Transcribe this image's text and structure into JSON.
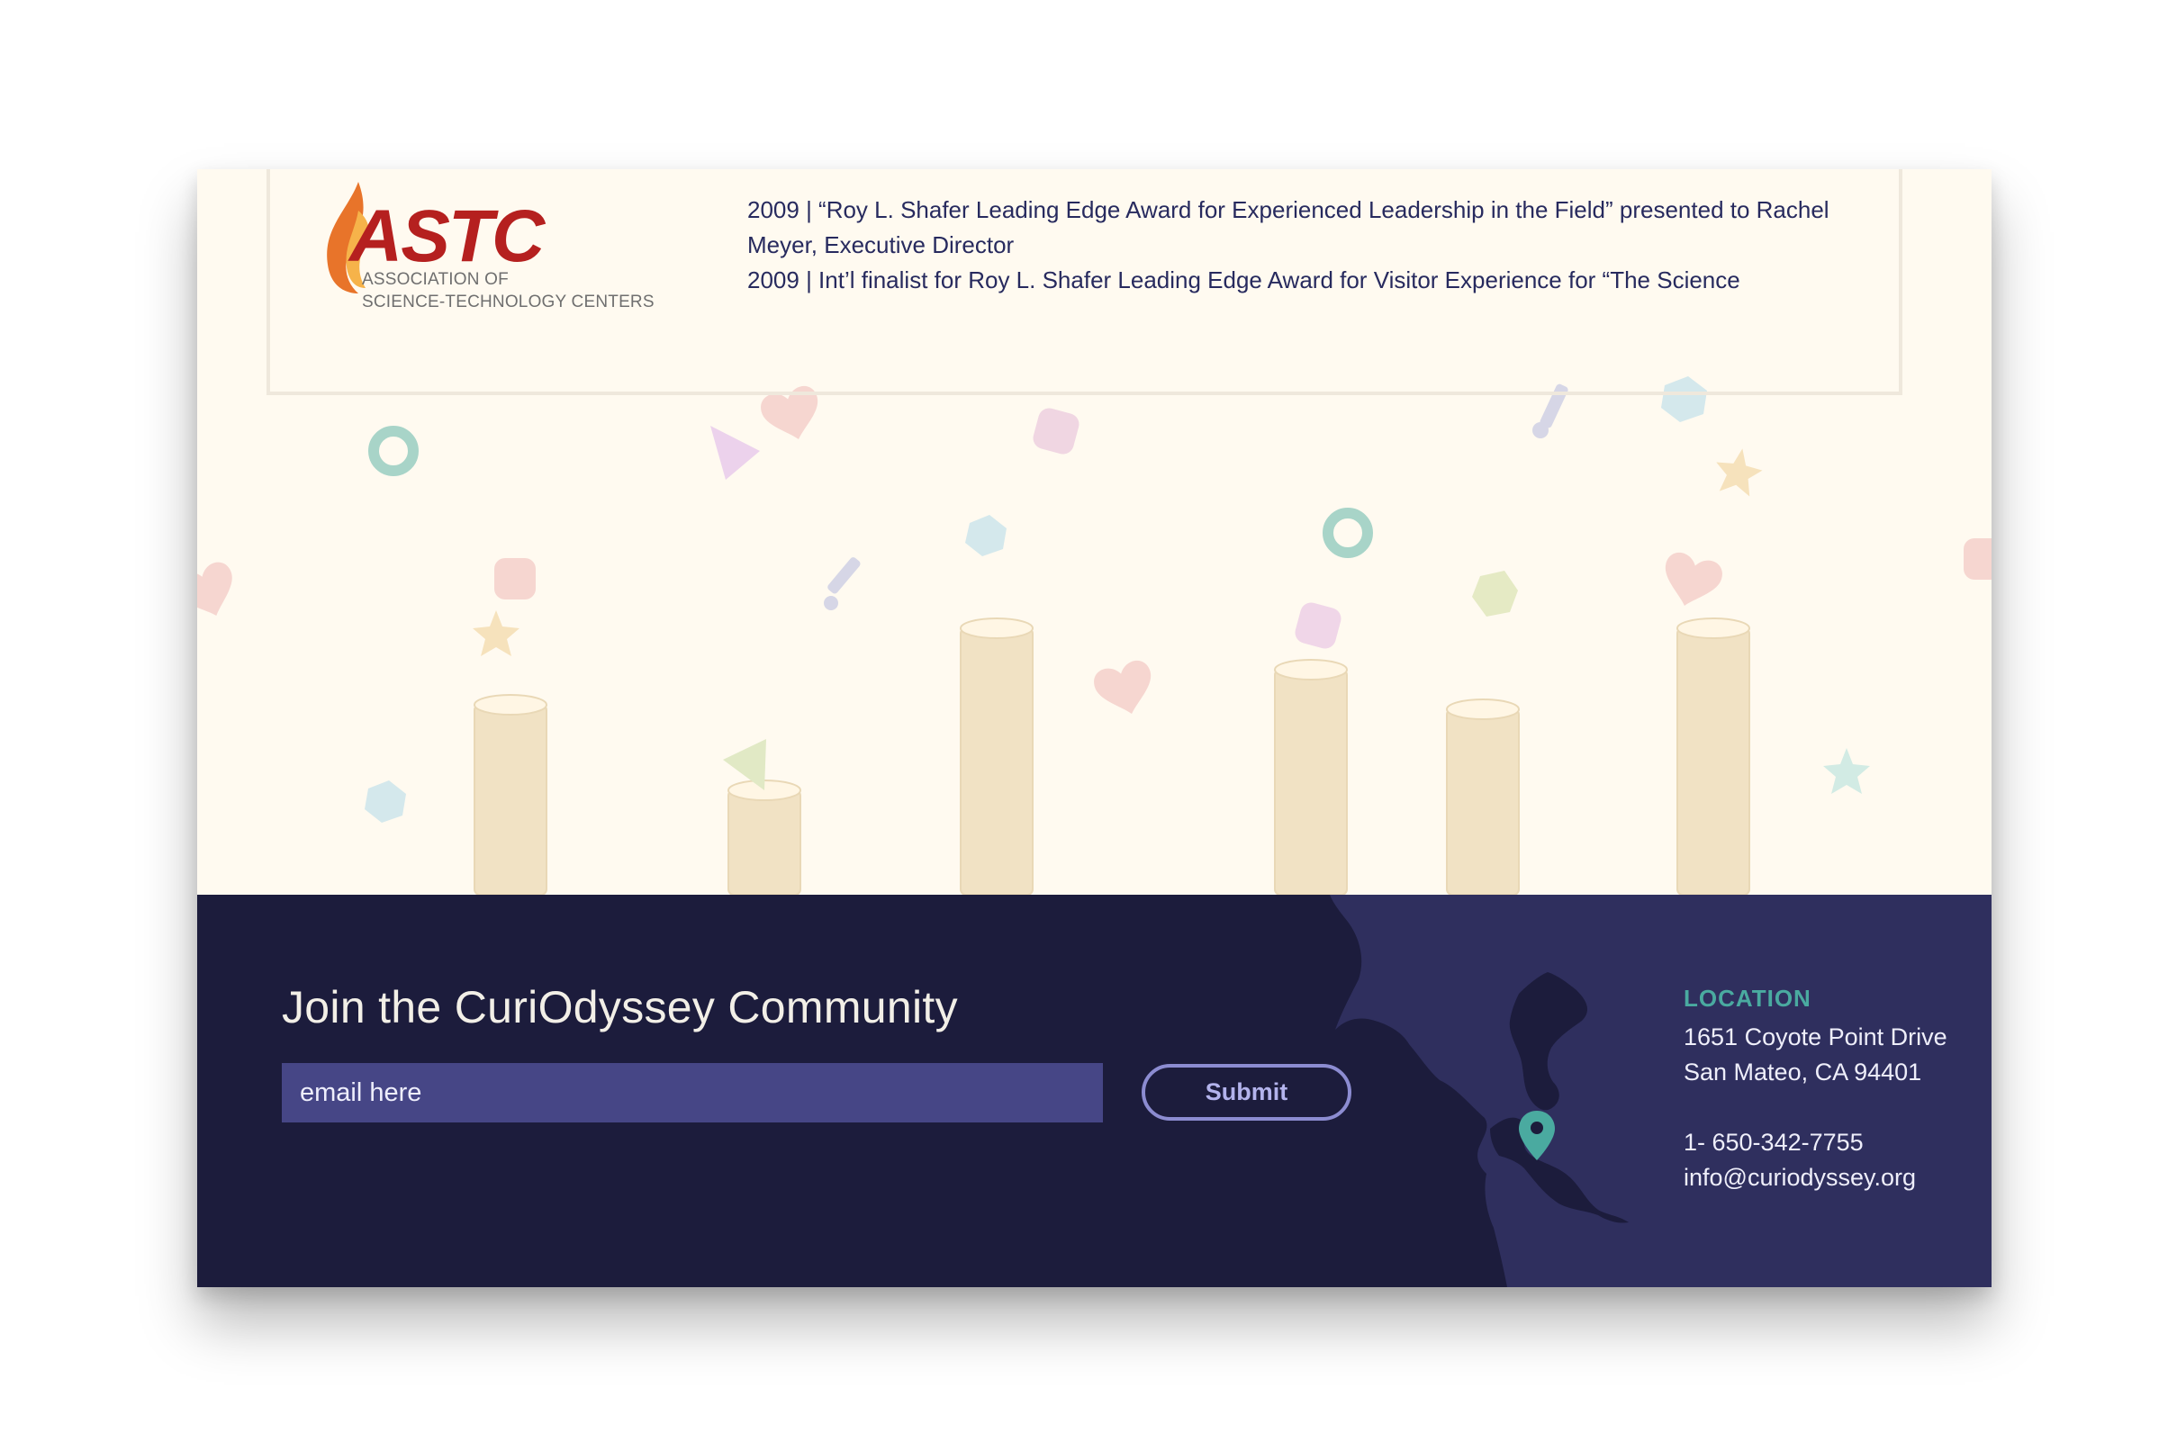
{
  "logo": {
    "mark_text": "ASTC",
    "subtitle_line1": "Association of",
    "subtitle_line2": "Science-Technology Centers"
  },
  "awards": [
    "2009 | “Roy L. Shafer Leading Edge Award for Experienced Leadership in the Field” presented to Rachel Meyer, Executive Director",
    "2009 | Int’l finalist for Roy L. Shafer Leading Edge Award for Visitor Experience for “The Science"
  ],
  "newsletter": {
    "title": "Join the CuriOdyssey Community",
    "email_placeholder": "email here",
    "submit_label": "Submit"
  },
  "location": {
    "title": "LOCATION",
    "address_line1": "1651 Coyote Point Drive",
    "address_line2": "San Mateo, CA 94401",
    "phone": "1- 650-342-7755",
    "email": "info@curiodyssey.org"
  },
  "colors": {
    "cream_bg": "#fffaf0",
    "navy_footer": "#1c1c3c",
    "map_land": "#2f2f5e",
    "input_bg": "#464686",
    "accent_teal": "#4aaaa0",
    "astc_red": "#b5201f"
  },
  "icons": [
    "map-pin-icon",
    "astc-logo-flame-icon"
  ]
}
